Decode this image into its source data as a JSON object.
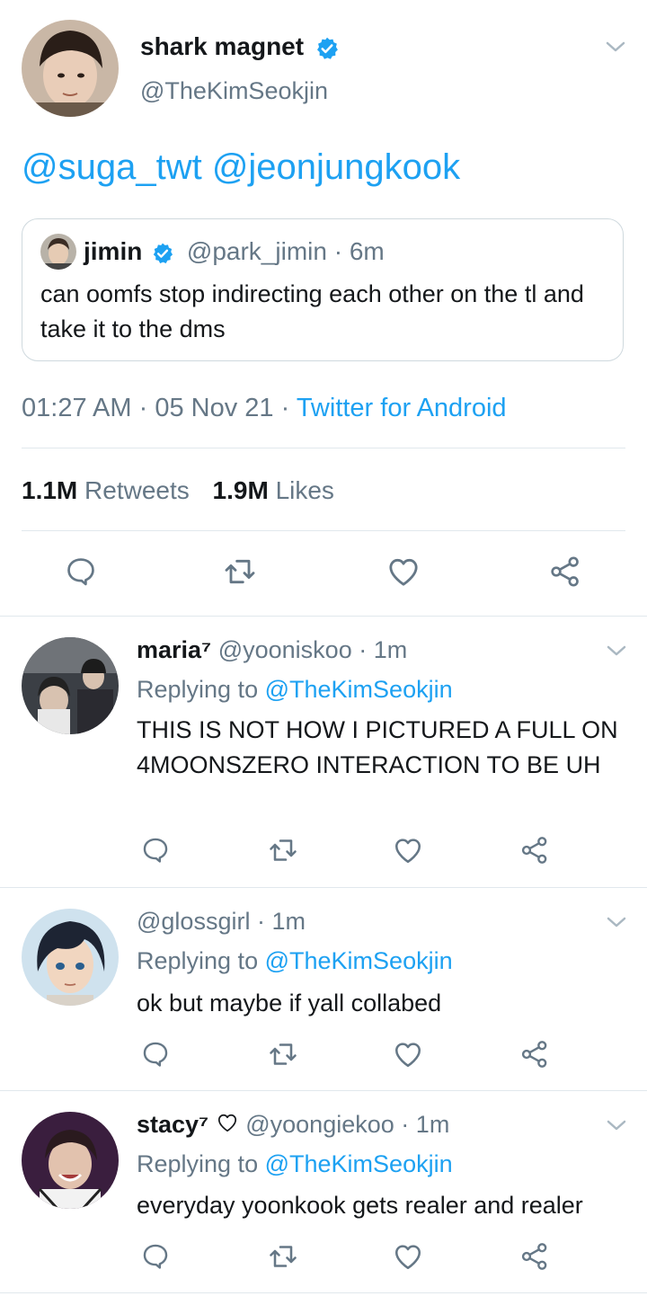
{
  "main_tweet": {
    "display_name": "shark magnet",
    "handle": "@TheKimSeokjin",
    "mentions": "@suga_twt @jeonjungkook",
    "quoted": {
      "display_name": "jimin",
      "handle": "@park_jimin",
      "sep": "·",
      "time": "6m",
      "text": "can oomfs stop indirecting each other on the tl and take it to the dms"
    },
    "time": "01:27 AM",
    "sep1": "·",
    "date": "05 Nov 21",
    "sep2": "·",
    "client": "Twitter for Android",
    "retweets_count": "1.1M",
    "retweets_label": "Retweets",
    "likes_count": "1.9M",
    "likes_label": "Likes"
  },
  "replies": [
    {
      "display_name": "maria⁷",
      "handle": "@yooniskoo",
      "sep": "·",
      "time": "1m",
      "replying_prefix": "Replying to",
      "replying_handle": "@TheKimSeokjin",
      "text": "THIS IS NOT HOW I PICTURED A FULL ON 4MOONSZERO INTERACTION TO BE UH"
    },
    {
      "display_name": "",
      "handle": "@glossgirl",
      "sep": "·",
      "time": "1m",
      "replying_prefix": "Replying to",
      "replying_handle": "@TheKimSeokjin",
      "text": "ok but maybe if yall collabed"
    },
    {
      "display_name": "stacy⁷",
      "handle": "@yoongiekoo",
      "sep": "·",
      "time": "1m",
      "replying_prefix": "Replying to",
      "replying_handle": "@TheKimSeokjin",
      "text": "everyday yoonkook gets realer and realer"
    }
  ],
  "colors": {
    "accent": "#1da1f2",
    "muted": "#657786",
    "text": "#14171a",
    "divider": "#e1e8ed"
  },
  "icons": {
    "reply": "speech-bubble-icon",
    "retweet": "retweet-icon",
    "like": "heart-icon",
    "share": "share-icon",
    "more": "chevron-down-icon",
    "verified": "verified-badge-icon"
  }
}
